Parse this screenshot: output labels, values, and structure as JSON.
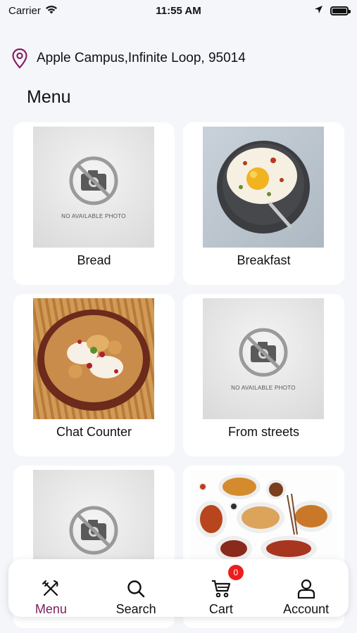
{
  "status_bar": {
    "carrier": "Carrier",
    "time": "11:55 AM"
  },
  "location": {
    "address": "Apple Campus,Infinite Loop, 95014",
    "icon": "location-pin-icon",
    "icon_color": "#8a1f63"
  },
  "menu_title": "Menu",
  "categories": [
    {
      "label": "Bread",
      "image": "no-photo-placeholder",
      "placeholder_text": "NO AVAILABLE PHOTO"
    },
    {
      "label": "Breakfast",
      "image": "breakfast-photo"
    },
    {
      "label": "Chat Counter",
      "image": "chat-counter-photo"
    },
    {
      "label": "From streets",
      "image": "no-photo-placeholder",
      "placeholder_text": "NO AVAILABLE PHOTO"
    },
    {
      "label": "",
      "image": "no-photo-placeholder",
      "placeholder_text": ""
    },
    {
      "label": "",
      "image": "assorted-dishes-photo"
    }
  ],
  "bottom_nav": {
    "active_color": "#7a1f5c",
    "items": [
      {
        "label": "Menu",
        "icon": "utensils-icon",
        "active": true
      },
      {
        "label": "Search",
        "icon": "search-icon",
        "active": false
      },
      {
        "label": "Cart",
        "icon": "cart-icon",
        "active": false,
        "badge": "0"
      },
      {
        "label": "Account",
        "icon": "user-icon",
        "active": false
      }
    ]
  }
}
